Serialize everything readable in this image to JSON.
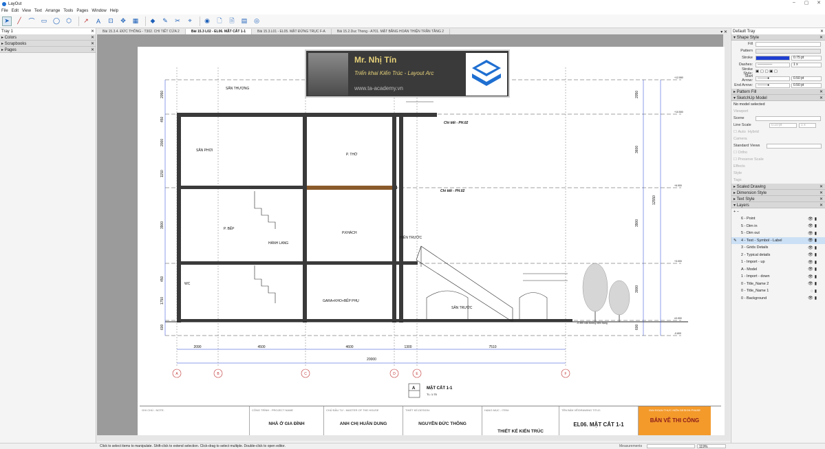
{
  "app": {
    "title": "LayOut"
  },
  "window_controls": [
    "–",
    "▢",
    "✕"
  ],
  "menu": [
    "File",
    "Edit",
    "View",
    "Text",
    "Arrange",
    "Tools",
    "Pages",
    "Window",
    "Help"
  ],
  "left_tray": {
    "title": "Tray 1",
    "sections": [
      "Colors",
      "Scrapbooks",
      "Pages"
    ]
  },
  "doc_tabs": [
    "Bài 15.3.4. ĐỨC THÔNG - T302. CHI TIẾT CỬA 2",
    "Bài 15.3 L02 - EL06. MẶT CẮT 1-1",
    "Bài 15.3.L01 - EL05. MẶT ĐỨNG TRỤC F-A",
    "Bài 15.2.Duc Thong - A701. MẶT BẰNG HOÀN THIỆN TRẦN TẦNG 2"
  ],
  "active_tab": 1,
  "banner": {
    "name": "Mr. Nhị Tín",
    "subtitle": "Triển khai Kiến Trúc - Layout Arc",
    "website": "www.ta-academy.vn"
  },
  "drawing": {
    "rooms": [
      "SÂN THƯỢNG",
      "SÂN PHƠI",
      "P. THỜ",
      "P. BẾP",
      "HÀNH LANG",
      "P.KHÁCH",
      "HIÊN TRƯỚC",
      "WC",
      "GARA+KHO+BẾP PHỤ",
      "SÂN TRƯỚC"
    ],
    "detail_labels": [
      "Chi tiết - PH.02",
      "Chi tiết - PH.02"
    ],
    "dim_bottom": [
      "2090",
      "4500",
      "4600",
      "1300",
      "7510"
    ],
    "dim_total": "20000",
    "grid_axes": [
      "A",
      "B",
      "C",
      "D",
      "E",
      "F"
    ],
    "dim_right": [
      "2050",
      "3600",
      "12550",
      "3900",
      "3000",
      "600"
    ],
    "dim_left": [
      "2050",
      "450",
      "2000",
      "1150",
      "3900",
      "450",
      "1750",
      "600"
    ],
    "levels": [
      "+12.550",
      "+10.500",
      "+6.900",
      "+3.000",
      "±0.000",
      "-0.600"
    ],
    "section_title": "MẶT CẮT 1-1",
    "section_letter": "A",
    "scale": "TL: 1:75",
    "ground_note": "-0.450 mặt đường hiện trạng"
  },
  "title_block": [
    {
      "cap": "GHI CHÚ - NOTE:",
      "val": ""
    },
    {
      "cap": "CÔNG TRÌNH - PROJECT NAME",
      "val": "NHÀ Ở GIA ĐÌNH"
    },
    {
      "cap": "CHỦ ĐẦU TƯ - MASTER OF THE HOUSE",
      "val": "ANH CHỊ HUÂN DUNG"
    },
    {
      "cap": "THIẾT KẾ-DESIGN:",
      "val": "NGUYỄN ĐỨC THÔNG"
    },
    {
      "cap": "HẠNG MỤC - ITEM:",
      "val": "THIẾT KẾ KIẾN TRÚC"
    },
    {
      "cap": "TÊN BẢN VẼ/DRAWING TITLE:",
      "val": "EL06. MẶT CẮT 1-1"
    },
    {
      "cap": "GIAI ĐOẠN THỰC HIỆN DESIGN PHASE",
      "val": "BẢN VẼ THI CÔNG"
    }
  ],
  "right_tray": {
    "title": "Default Tray",
    "shape_style": {
      "header": "Shape Style",
      "fill": "Fill",
      "pattern": "Pattern",
      "stroke": "Stroke",
      "stroke_value": "0.75 pt",
      "dashes": "Dashes:",
      "dash_scale": "1 x",
      "stroke_style": "Stroke Style:",
      "start_arrow": "Start Arrow:",
      "start_val": "0.50 pt",
      "end_arrow": "End Arrow:",
      "end_val": "0.50 pt"
    },
    "pattern_fill": "Pattern Fill",
    "sketchup_model": {
      "header": "SketchUp Model",
      "no_model": "No model selected",
      "viewport": "Viewport",
      "scene": "Scene",
      "line_scale": "Line Scale",
      "line_val": "0.10 pt",
      "line_mult": "1 x",
      "auto": "Auto",
      "render": "Hybrid",
      "camera": "Camera",
      "standard_views": "Standard Views",
      "ortho": "Ortho",
      "preserve_scale": "Preserve Scale",
      "effects": "Effects",
      "style": "Style",
      "tags": "Tags"
    },
    "collapsed": [
      "Scaled Drawing",
      "Dimension Style",
      "Text Style"
    ],
    "layers": {
      "header": "Layers",
      "items": [
        "6 - Point",
        "5 - Dim in",
        "5 - Dim out",
        "4 - Text - Symbol - Label",
        "3 - Grids Details",
        "2 - Typical details",
        "1 - Import - up",
        "A - Model",
        "1 - Import - down",
        "0 - Title_Name 2",
        "0 - Title_Name 1",
        "0 - Background"
      ],
      "active": 3
    }
  },
  "status": {
    "hint": "Click to select items to manipulate. Shift-click to extend selection. Click-drag to select multiple. Double-click to open editor.",
    "measurements": "Measurements",
    "zoom": "119%"
  },
  "colors": {
    "accent": "#1f6fd1",
    "orange": "#f39a2b",
    "layer_active": "#cce0f5"
  }
}
